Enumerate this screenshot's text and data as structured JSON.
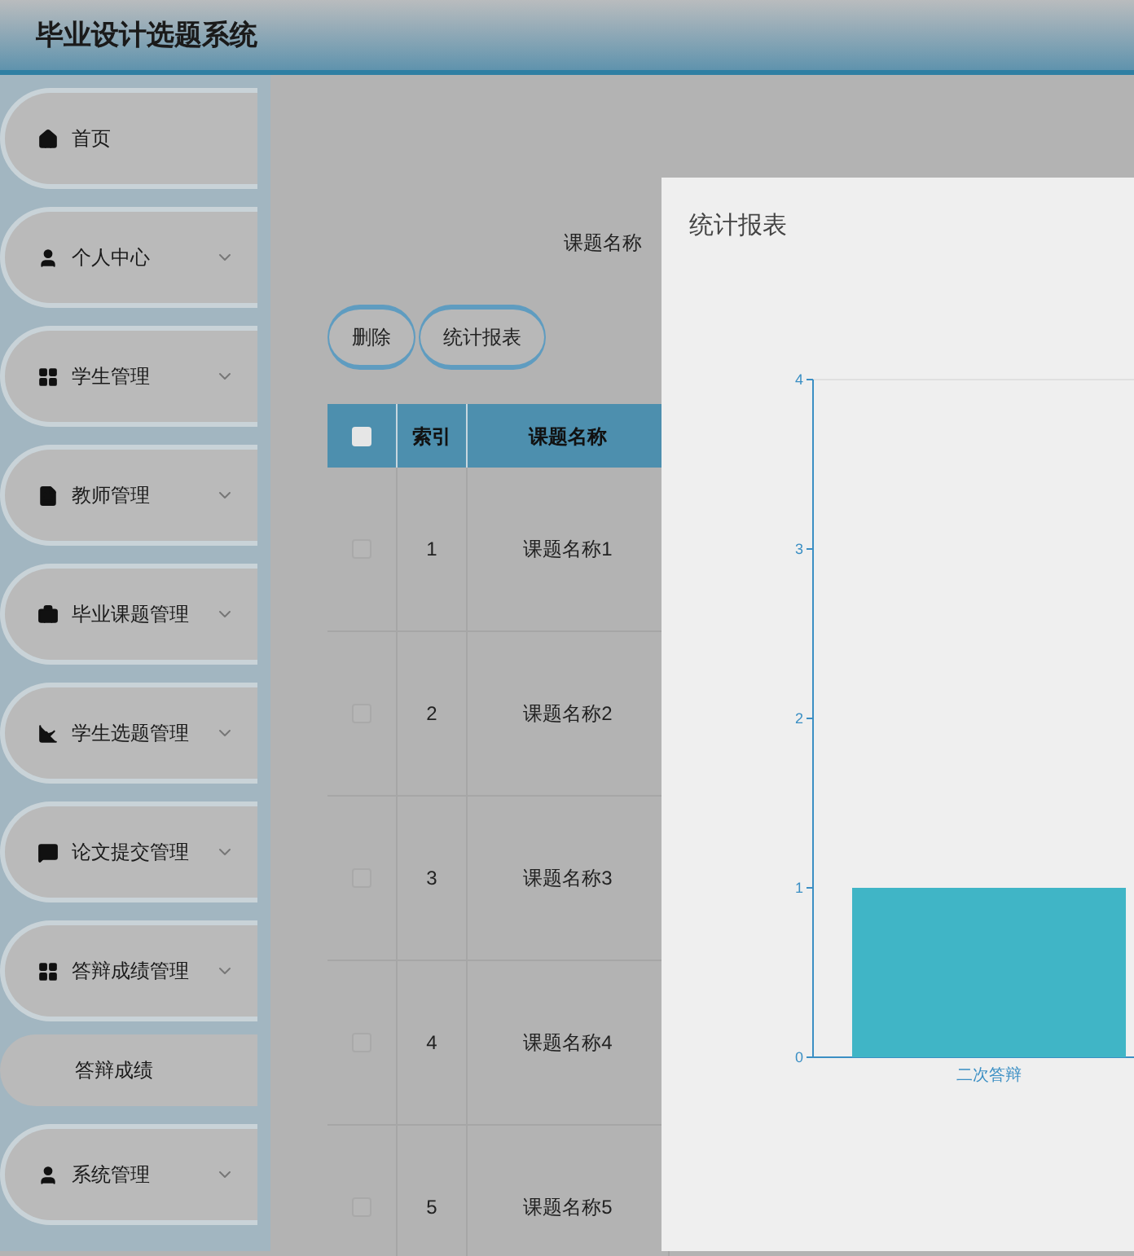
{
  "header": {
    "title": "毕业设计选题系统"
  },
  "sidebar": {
    "items": [
      {
        "label": "首页",
        "expandable": false
      },
      {
        "label": "个人中心",
        "expandable": true
      },
      {
        "label": "学生管理",
        "expandable": true
      },
      {
        "label": "教师管理",
        "expandable": true
      },
      {
        "label": "毕业课题管理",
        "expandable": true
      },
      {
        "label": "学生选题管理",
        "expandable": true
      },
      {
        "label": "论文提交管理",
        "expandable": true
      },
      {
        "label": "答辩成绩管理",
        "expandable": true,
        "children": [
          {
            "label": "答辩成绩"
          }
        ]
      },
      {
        "label": "系统管理",
        "expandable": true
      }
    ]
  },
  "search": {
    "label": "课题名称"
  },
  "actions": [
    "删除",
    "统计报表"
  ],
  "table": {
    "all_checked": false,
    "columns": [
      "索引",
      "课题名称"
    ],
    "rows": [
      {
        "checked": false,
        "cells": [
          "1",
          "课题名称1"
        ]
      },
      {
        "checked": false,
        "cells": [
          "2",
          "课题名称2"
        ]
      },
      {
        "checked": false,
        "cells": [
          "3",
          "课题名称3"
        ]
      },
      {
        "checked": false,
        "cells": [
          "4",
          "课题名称4"
        ]
      },
      {
        "checked": false,
        "cells": [
          "5",
          "课题名称5"
        ]
      }
    ]
  },
  "dialog": {
    "title": "统计报表",
    "chart_data": {
      "type": "bar",
      "categories": [
        "二次答辩"
      ],
      "values": [
        1
      ],
      "ylim": [
        0,
        4
      ],
      "yticks": [
        0,
        1,
        2,
        3,
        4
      ]
    }
  }
}
